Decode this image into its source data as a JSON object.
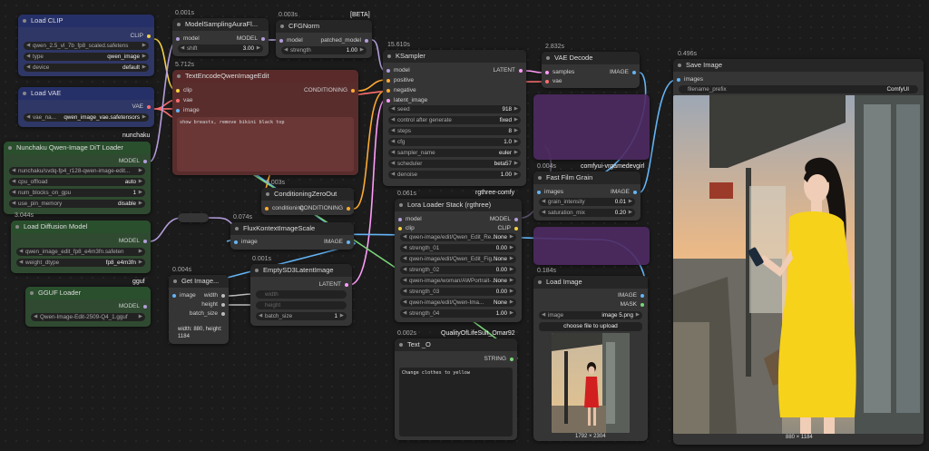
{
  "colors": {
    "clip": "#f5d142",
    "vae": "#ff6e6e",
    "model": "#b39ddb",
    "conditioning": "#ffa931",
    "latent": "#ff9cf9",
    "image": "#64b5f6",
    "string": "#7bd67b",
    "int": "#bbbbbb"
  },
  "badges": {
    "beta": "[BETA]",
    "nunchaku": "nunchaku",
    "gguf": "gguf",
    "rgthree": "rgthree-comfy",
    "comfyui_vrgame": "comfyui-vrgamedevgirl",
    "qol": "QualityOfLifeSuit_Omar92"
  },
  "nodes": {
    "load_clip": {
      "title": "Load CLIP",
      "out": "CLIP",
      "clip_name": "qwen_2.5_vl_7b_fp8_scaled.safetens",
      "type_label": "type",
      "type": "qwen_image",
      "device_label": "device",
      "device": "default"
    },
    "load_vae": {
      "title": "Load VAE",
      "out": "VAE",
      "vae_label": "vae_na...",
      "vae_name": "qwen_image_vae.safetensors"
    },
    "nunchaku": {
      "title": "Nunchaku Qwen-Image DiT Loader",
      "out": "MODEL",
      "model_path": "nunchaku/svdq-fp4_r128-qwen-image-edit...",
      "cpu_offload_label": "cpu_offload",
      "cpu_offload": "auto",
      "num_blocks_label": "num_blocks_on_gpu",
      "num_blocks": "1",
      "use_pin_label": "use_pin_memory",
      "use_pin": "disable"
    },
    "load_diffusion": {
      "time": "3.044s",
      "title": "Load Diffusion Model",
      "out": "MODEL",
      "unet_name": "qwen_image_edit_fp8_e4m3fn.safeten",
      "dtype_label": "weight_dtype",
      "dtype": "fp8_e4m3fn"
    },
    "gguf": {
      "title": "GGUF Loader",
      "out": "MODEL",
      "model": "Qwen-Image-Edit-2509-Q4_1.gguf"
    },
    "model_sampling": {
      "time": "0.001s",
      "title": "ModelSamplingAuraFl...",
      "in_model": "model",
      "out": "MODEL",
      "shift_label": "shift",
      "shift": "3.00"
    },
    "cfgnorm": {
      "time": "0.003s",
      "title": "CFGNorm",
      "in_model": "model",
      "out": "patched_model",
      "strength_label": "strength",
      "strength": "1.00"
    },
    "text_encode": {
      "time": "5.712s",
      "title": "TextEncodeQwenImageEdit",
      "in_clip": "clip",
      "in_vae": "vae",
      "in_image": "image",
      "out": "CONDITIONING",
      "prompt": "show breasts, remove bikini black top"
    },
    "cond_zero": {
      "time": "0.003s",
      "title": "ConditioningZeroOut",
      "in": "conditioning",
      "out": "CONDITIONING"
    },
    "ksampler": {
      "time": "15.610s",
      "title": "KSampler",
      "in_model": "model",
      "in_positive": "positive",
      "in_negative": "negative",
      "in_latent": "latent_image",
      "out": "LATENT",
      "widgets": [
        {
          "name": "seed",
          "value": "918"
        },
        {
          "name": "control after generate",
          "value": "fixed"
        },
        {
          "name": "steps",
          "value": "8"
        },
        {
          "name": "cfg",
          "value": "1.0"
        },
        {
          "name": "sampler_name",
          "value": "euler"
        },
        {
          "name": "scheduler",
          "value": "beta57"
        },
        {
          "name": "denoise",
          "value": "1.00"
        }
      ]
    },
    "vae_decode": {
      "time": "2.832s",
      "title": "VAE Decode",
      "in_samples": "samples",
      "in_vae": "vae",
      "out": "IMAGE"
    },
    "film_grain": {
      "time": "0.004s",
      "title": "Fast Film Grain",
      "in": "images",
      "out": "IMAGE",
      "grain_label": "grain_intensity",
      "grain": "0.01",
      "sat_label": "saturation_mix",
      "sat": "0.20"
    },
    "lora": {
      "time": "0.061s",
      "title": "Lora Loader Stack (rgthree)",
      "in_model": "model",
      "in_clip": "clip",
      "out_model": "MODEL",
      "out_clip": "CLIP",
      "widgets": [
        {
          "name": "qwen-image/edit/Qwen_Edit_Re...",
          "value": "None"
        },
        {
          "name": "strength_01",
          "value": "0.00"
        },
        {
          "name": "qwen-image/edit/Qwen_Edit_Fig...",
          "value": "None"
        },
        {
          "name": "strength_02",
          "value": "0.00"
        },
        {
          "name": "qwen-image/woman/AWPortrait-...",
          "value": "None"
        },
        {
          "name": "strength_03",
          "value": "0.00"
        },
        {
          "name": "qwen-image/edit/Qwen-Ima...",
          "value": "None"
        },
        {
          "name": "strength_04",
          "value": "1.00"
        }
      ]
    },
    "flux_scale": {
      "time": "0.074s",
      "title": "FluxKontextImageScale",
      "in": "image",
      "out": "IMAGE"
    },
    "get_image": {
      "time": "0.004s",
      "title": "Get Image...",
      "in": "image",
      "width": "width",
      "height": "height",
      "batch": "batch_size",
      "info": "width: 880, height: 1184"
    },
    "empty_latent": {
      "time": "0.001s",
      "title": "EmptySD3LatentImage",
      "out": "LATENT",
      "width": "width",
      "height": "height",
      "batch_label": "batch_size",
      "batch": "1"
    },
    "text_o": {
      "time": "0.002s",
      "title": "Text _O",
      "out": "STRING",
      "text": "Change clothes to yellow"
    },
    "load_image": {
      "time": "0.184s",
      "title": "Load Image",
      "out_image": "IMAGE",
      "out_mask": "MASK",
      "image_label": "image",
      "image": "image 5.png",
      "upload": "choose file to upload",
      "dims": "1792 × 2304"
    },
    "save_image": {
      "time": "0.496s",
      "title": "Save Image",
      "in": "images",
      "prefix_label": "filename_prefix",
      "prefix": "ComfyUI",
      "dims": "880 × 1184"
    }
  }
}
